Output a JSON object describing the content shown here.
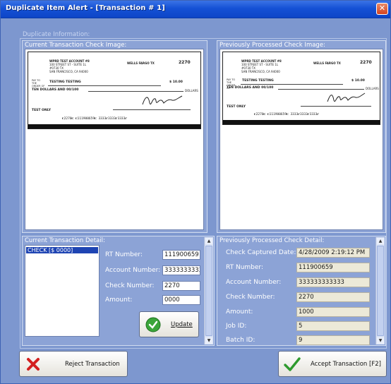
{
  "window": {
    "title": "Duplicate Item Alert - [Transaction # 1]",
    "close_glyph": "✕"
  },
  "section_label": "Duplicate Information:",
  "current_image": {
    "title": "Current Transaction Check Image:",
    "check": {
      "payer_lines": [
        "WPRD TEST ACCOUNT #8",
        "100 STREET ST - SUITE 1L",
        "#0730 TX",
        "SAN FRANCISCO, CA 94000"
      ],
      "bank": "WELLS FARGO TX",
      "number": "2270",
      "pay_to_label": "PAY TO THE ORDER OF",
      "payee": "TESTING TESTING",
      "amount": "$ 10.00",
      "written": "TEN DOLLARS AND 00/100",
      "dollars": "DOLLARS",
      "memo": "TEST ONLY",
      "micr": "⑆2270⑆ ⑆111900659⑆ 3333⑈3333⑈3333⑈"
    }
  },
  "previous_image": {
    "title": "Previously Processed Check Image:",
    "check": {
      "payer_lines": [
        "WPRD TEST ACCOUNT #8",
        "100 STREET ST - SUITE 1L",
        "#0730 TX",
        "SAN FRANCISCO, CA 94000"
      ],
      "bank": "WELLS FARGO TX",
      "number": "2270",
      "pay_to_label": "PAY TO THE ORDER OF",
      "payee": "TESTING TESTING",
      "amount": "$ 10.00",
      "written": "TEN DOLLARS AND 00/100",
      "dollars": "DOLLARS",
      "memo": "TEST ONLY",
      "micr": "⑆2270⑆ ⑆111900659⑆ 3333⑈3333⑈3333⑈"
    }
  },
  "current_detail": {
    "title": "Current Transaction Detail:",
    "list_items": [
      "CHECK [$ 0000]"
    ],
    "rt_label": "RT Number:",
    "rt_value": "111900659",
    "account_label": "Account Number:",
    "account_value": "333333333333",
    "check_label": "Check Number:",
    "check_value": "2270",
    "amount_label": "Amount:",
    "amount_value": "0000",
    "update_button": "Update"
  },
  "previous_detail": {
    "title": "Previously Processed Check Detail:",
    "fields": [
      {
        "label": "Check Captured Date:",
        "value": "4/28/2009 2:19:12 PM"
      },
      {
        "label": "RT Number:",
        "value": "111900659"
      },
      {
        "label": "Account Number:",
        "value": "333333333333"
      },
      {
        "label": "Check Number:",
        "value": "2270"
      },
      {
        "label": "Amount:",
        "value": "1000"
      },
      {
        "label": "Job ID:",
        "value": "5"
      },
      {
        "label": "Batch ID:",
        "value": "9"
      }
    ]
  },
  "actions": {
    "reject_label": "Reject Transaction",
    "accept_label": "Accept Transaction [F2]"
  },
  "colors": {
    "accent": "#1551d5",
    "reject": "#d32020",
    "accept": "#2e9a2e"
  }
}
